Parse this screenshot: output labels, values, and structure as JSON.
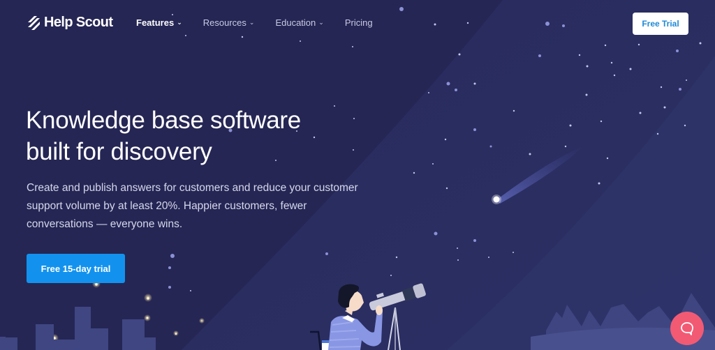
{
  "brand": {
    "name": "Help Scout"
  },
  "nav": {
    "items": [
      {
        "label": "Features",
        "has_dropdown": true,
        "active": true
      },
      {
        "label": "Resources",
        "has_dropdown": true,
        "active": false
      },
      {
        "label": "Education",
        "has_dropdown": true,
        "active": false
      },
      {
        "label": "Pricing",
        "has_dropdown": false,
        "active": false
      }
    ],
    "cta_label": "Free Trial"
  },
  "hero": {
    "title_line1": "Knowledge base software",
    "title_line2": "built for discovery",
    "subtitle": "Create and publish answers for customers and reduce your customer support volume by at least 20%. Happier customers, fewer conversations — everyone wins.",
    "cta_label": "Free 15-day trial"
  },
  "icons": {
    "chevron": "chevron-down-icon",
    "chat": "chat-bubble-icon",
    "logo": "help-scout-logo-icon"
  },
  "colors": {
    "background": "#252654",
    "primary_button": "#1292ee",
    "chat_button": "#f25a74",
    "top_button_text": "#1f8ad6"
  }
}
